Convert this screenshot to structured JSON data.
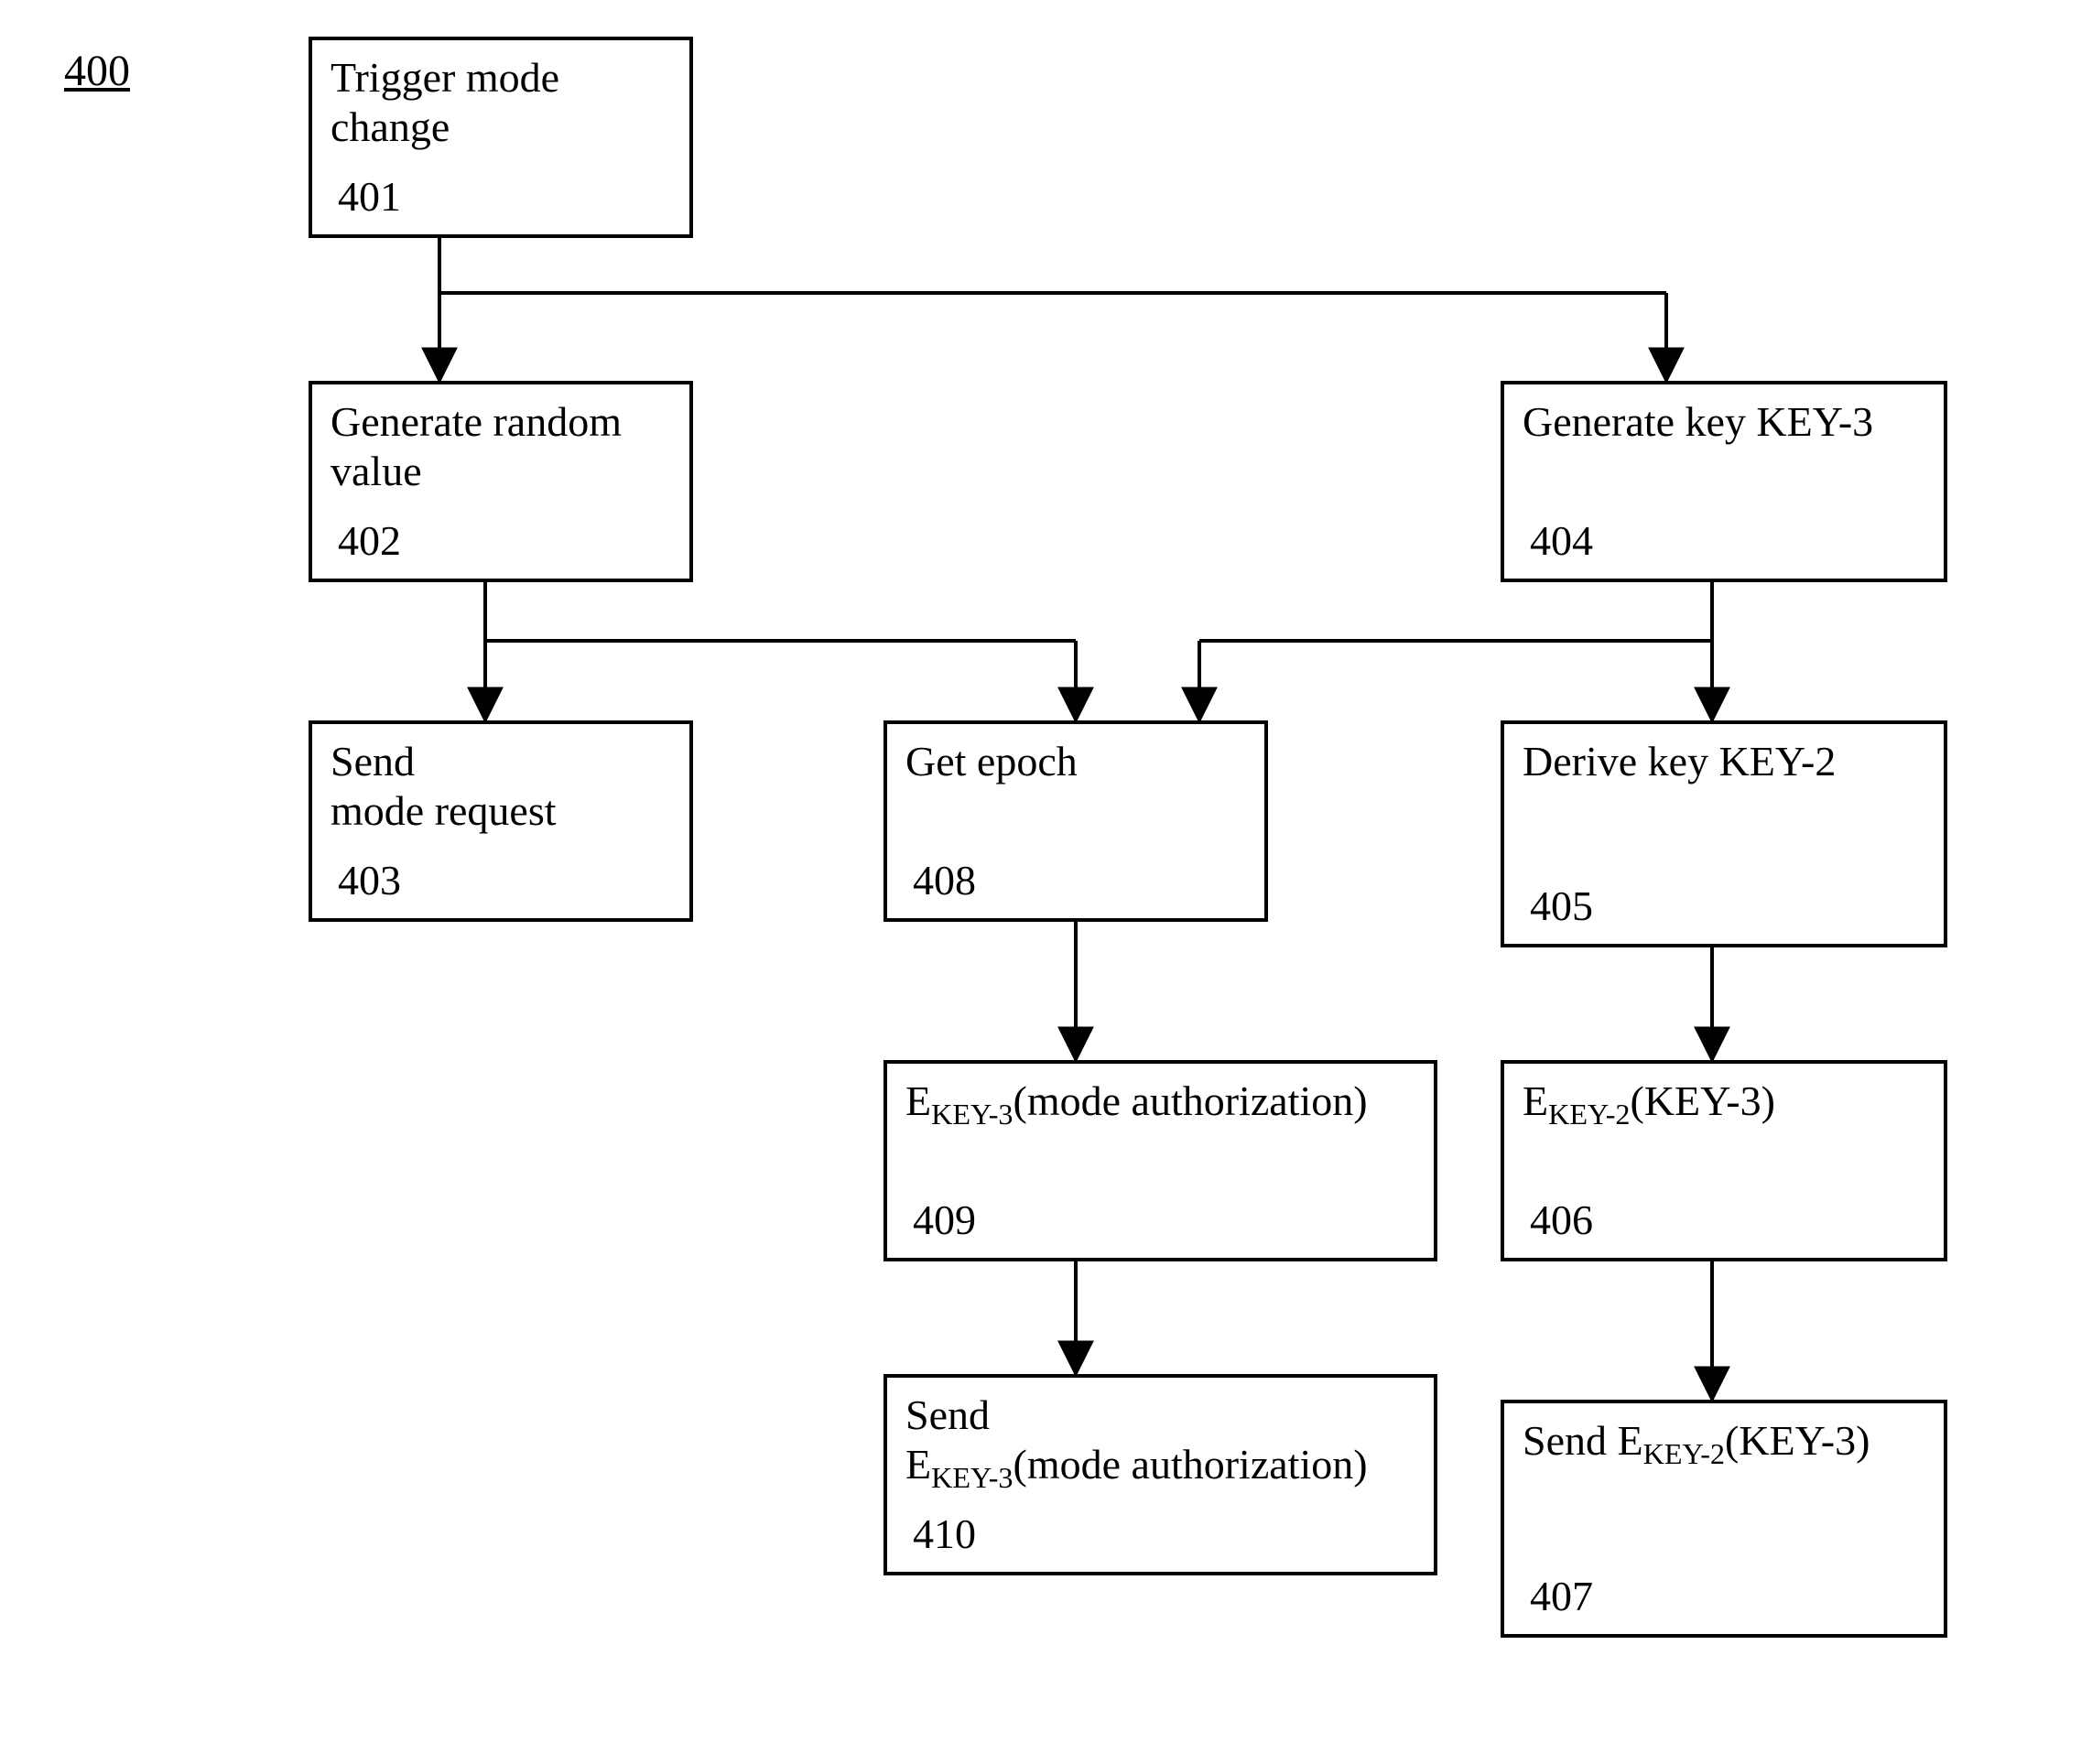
{
  "figure_label": "400",
  "boxes": {
    "b401": {
      "text_line1": "Trigger mode",
      "text_line2": "change",
      "num": "401"
    },
    "b402": {
      "text_line1": "Generate random",
      "text_line2": "value",
      "num": "402"
    },
    "b403": {
      "text_line1": "Send",
      "text_line2": "mode request",
      "num": "403"
    },
    "b404": {
      "text_line1": "Generate key KEY-3",
      "num": "404"
    },
    "b405": {
      "text_line1": "Derive key KEY-2",
      "num": "405"
    },
    "b406": {
      "text_pre": "E",
      "text_sub": "KEY-2",
      "text_post": "(KEY-3)",
      "num": "406"
    },
    "b407": {
      "text_plain": "Send E",
      "text_sub": "KEY-2",
      "text_post": "(KEY-3)",
      "num": "407"
    },
    "b408": {
      "text_line1": "Get epoch",
      "num": "408"
    },
    "b409": {
      "text_pre": "E",
      "text_sub": "KEY-3",
      "text_post": "(mode authorization)",
      "num": "409"
    },
    "b410": {
      "text_line1": "Send",
      "text_pre": "E",
      "text_sub": "KEY-3",
      "text_post": "(mode authorization)",
      "num": "410"
    }
  }
}
